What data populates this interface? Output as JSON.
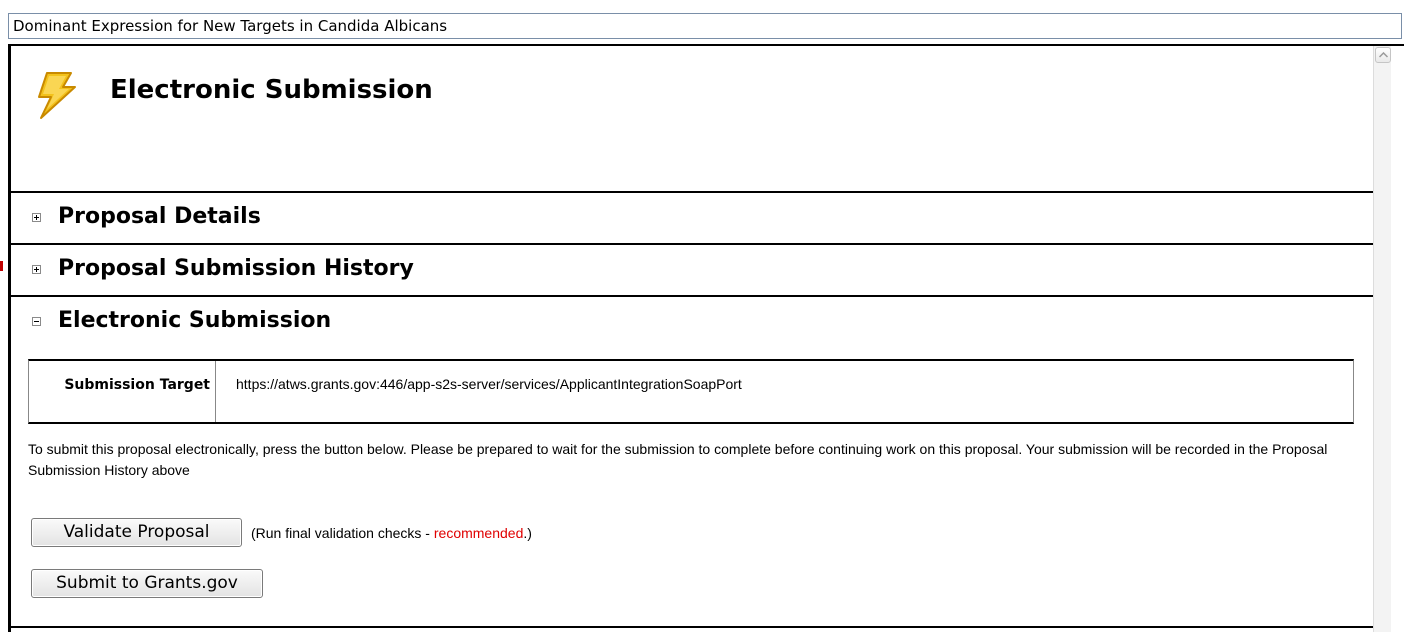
{
  "window": {
    "title": "Dominant Expression for New Targets in Candida Albicans"
  },
  "header": {
    "icon": "lightning-bolt-icon",
    "title": "Electronic Submission"
  },
  "sections": [
    {
      "label": "Proposal Details",
      "state": "collapsed",
      "toggle_icon": "plus-expand-icon"
    },
    {
      "label": "Proposal Submission History",
      "state": "collapsed",
      "toggle_icon": "plus-expand-icon"
    },
    {
      "label": "Electronic Submission",
      "state": "expanded",
      "toggle_icon": "minus-collapse-icon"
    }
  ],
  "submission": {
    "target_label": "Submission Target",
    "target_url": "https://atws.grants.gov:446/app-s2s-server/services/ApplicantIntegrationSoapPort",
    "instructions": "To submit this proposal electronically, press the button below. Please be prepared to wait for the submission to complete before continuing work on this proposal. Your submission will be recorded in the Proposal Submission History above",
    "validate_button": "Validate Proposal",
    "validate_note_prefix": "(Run final validation checks - ",
    "validate_note_emphasis": "recommended",
    "validate_note_suffix": ".)",
    "submit_button": "Submit to Grants.gov"
  },
  "colors": {
    "emphasis": "#e00000",
    "icon_gold": "#f3c21b",
    "border": "#000000"
  }
}
